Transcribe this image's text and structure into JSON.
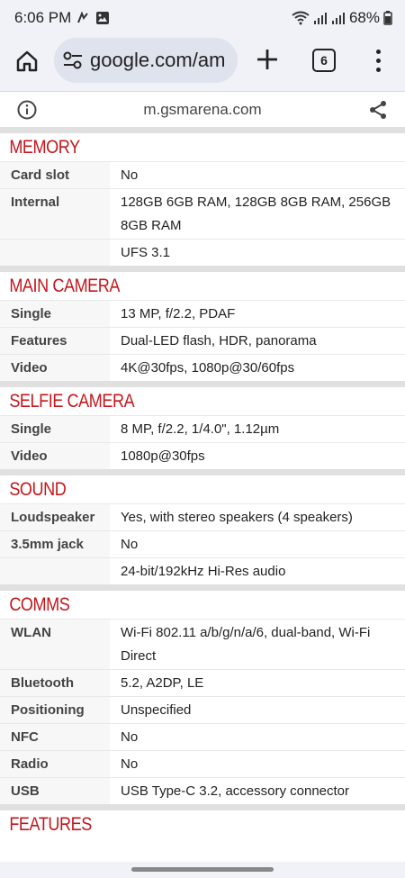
{
  "status_bar": {
    "time": "6:06 PM",
    "battery": "68%",
    "icons": [
      "nfc-icon",
      "image-icon",
      "wifi-icon",
      "signal-icon",
      "signal-icon",
      "battery-icon"
    ]
  },
  "browser": {
    "url": "google.com/am",
    "tab_count": "6",
    "domain": "m.gsmarena.com"
  },
  "sections": [
    {
      "title": "MEMORY",
      "rows": [
        {
          "label": "Card slot",
          "value": "No"
        },
        {
          "label": "Internal",
          "value": "128GB 6GB RAM, 128GB 8GB RAM, 256GB 8GB RAM"
        },
        {
          "label": "",
          "value": "UFS 3.1"
        }
      ]
    },
    {
      "title": "MAIN CAMERA",
      "rows": [
        {
          "label": "Single",
          "value": "13 MP, f/2.2, PDAF"
        },
        {
          "label": "Features",
          "value": "Dual-LED flash, HDR, panorama"
        },
        {
          "label": "Video",
          "value": "4K@30fps, 1080p@30/60fps"
        }
      ]
    },
    {
      "title": "SELFIE CAMERA",
      "rows": [
        {
          "label": "Single",
          "value": "8 MP, f/2.2, 1/4.0\", 1.12µm"
        },
        {
          "label": "Video",
          "value": "1080p@30fps"
        }
      ]
    },
    {
      "title": "SOUND",
      "rows": [
        {
          "label": "Loudspeaker",
          "value": "Yes, with stereo speakers (4 speakers)"
        },
        {
          "label": "3.5mm jack",
          "value": "No"
        },
        {
          "label": "",
          "value": "24-bit/192kHz Hi-Res audio"
        }
      ]
    },
    {
      "title": "COMMS",
      "rows": [
        {
          "label": "WLAN",
          "value": "Wi-Fi 802.11 a/b/g/n/a/6, dual-band, Wi-Fi Direct"
        },
        {
          "label": "Bluetooth",
          "value": "5.2, A2DP, LE"
        },
        {
          "label": "Positioning",
          "value": "Unspecified"
        },
        {
          "label": "NFC",
          "value": "No"
        },
        {
          "label": "Radio",
          "value": "No"
        },
        {
          "label": "USB",
          "value": "USB Type-C 3.2, accessory connector"
        }
      ]
    },
    {
      "title": "FEATURES",
      "rows": []
    }
  ],
  "colors": {
    "section_title": "#c4161c",
    "section_gap": "#e0e0e0",
    "toolbar": "#f0f2f8"
  }
}
